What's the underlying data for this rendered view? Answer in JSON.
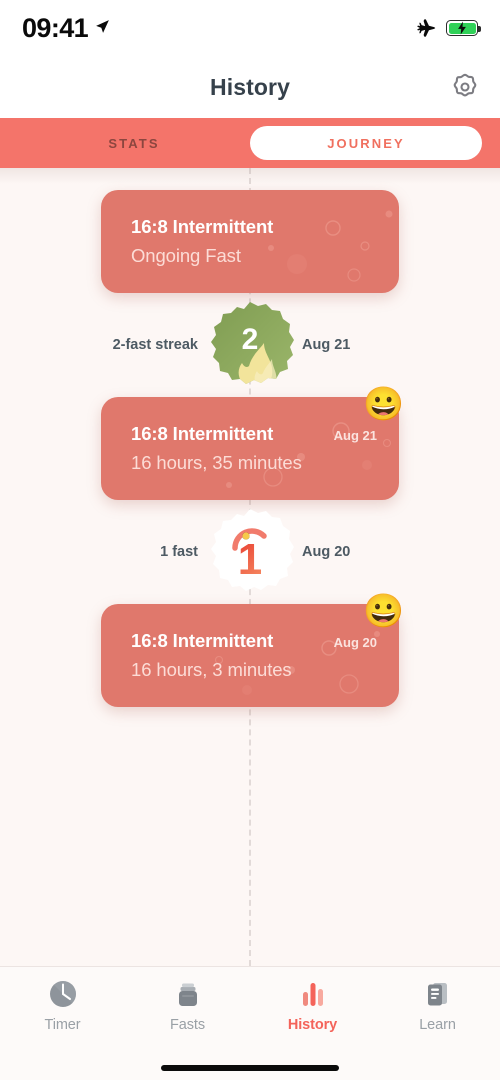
{
  "status_bar": {
    "time": "09:41",
    "location_icon": "location-arrow-icon",
    "airplane_icon": "airplane-mode-icon",
    "battery_icon": "battery-charging-icon",
    "battery_color": "#30D158"
  },
  "header": {
    "title": "History",
    "settings_icon": "gear-icon"
  },
  "segmented_control": {
    "tabs": [
      {
        "label": "STATS",
        "active": false
      },
      {
        "label": "JOURNEY",
        "active": true
      }
    ],
    "bar_color": "#F4746A",
    "active_text_color": "#F0705F",
    "inactive_text_color": "#8C463F"
  },
  "journey": {
    "card_color": "#E0786C",
    "entries": [
      {
        "type": "fast",
        "title": "16:8 Intermittent",
        "subtitle": "Ongoing Fast",
        "date": "",
        "emoji": ""
      },
      {
        "type": "milestone",
        "label": "2-fast streak",
        "date": "Aug 21",
        "count": "2",
        "badge": "streak-badge-green"
      },
      {
        "type": "fast",
        "title": "16:8 Intermittent",
        "subtitle": "16 hours, 35 minutes",
        "date": "Aug 21",
        "emoji": "😀"
      },
      {
        "type": "milestone",
        "label": "1 fast",
        "date": "Aug 20",
        "count": "1",
        "badge": "first-fast-badge-white"
      },
      {
        "type": "fast",
        "title": "16:8 Intermittent",
        "subtitle": "16 hours, 3 minutes",
        "date": "Aug 20",
        "emoji": "😀"
      }
    ]
  },
  "bottom_nav": {
    "active_color": "#F4635A",
    "inactive_color": "#9AA0A6",
    "items": [
      {
        "label": "Timer",
        "icon": "clock-icon",
        "active": false
      },
      {
        "label": "Fasts",
        "icon": "jar-icon",
        "active": false
      },
      {
        "label": "History",
        "icon": "bar-chart-icon",
        "active": true
      },
      {
        "label": "Learn",
        "icon": "document-icon",
        "active": false
      }
    ]
  }
}
